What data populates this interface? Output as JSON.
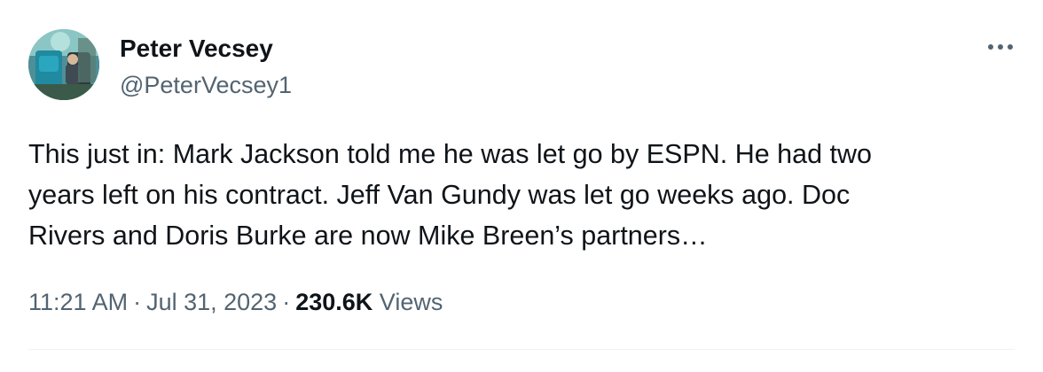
{
  "author": {
    "display_name": "Peter Vecsey",
    "handle": "@PeterVecsey1"
  },
  "tweet": {
    "text": "This just in: Mark Jackson told me he was let go by ESPN. He had two\nyears left on his contract. Jeff Van Gundy was let go weeks ago. Doc\nRivers and Doris Burke are now Mike Breen’s partners…",
    "time": "11:21 AM",
    "separator": "·",
    "date": "Jul 31, 2023",
    "views_count": "230.6K",
    "views_label": "Views"
  },
  "icons": {
    "more": "more-horizontal-icon",
    "avatar": "profile-avatar"
  },
  "colors": {
    "primary_text": "#0f1419",
    "secondary_text": "#536471",
    "divider": "#eff3f4"
  }
}
